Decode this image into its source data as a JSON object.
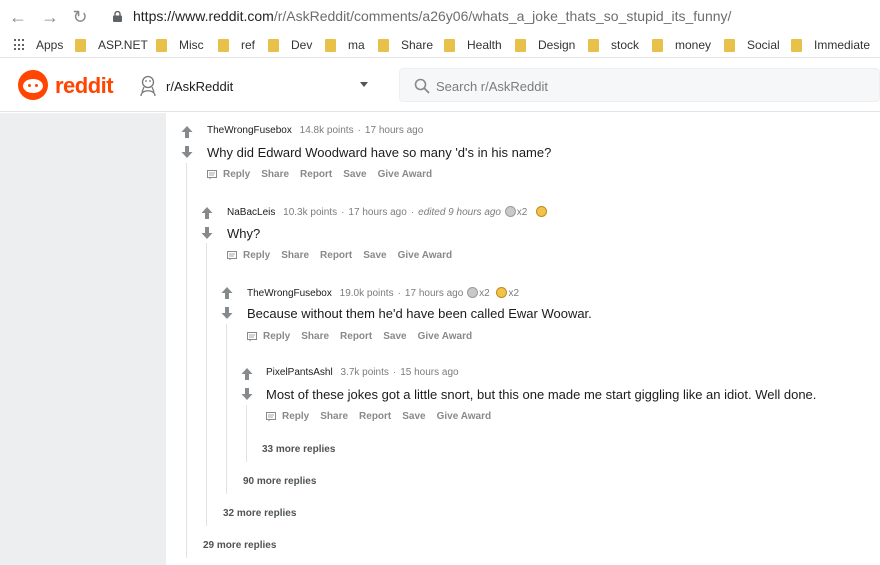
{
  "browser": {
    "url_host": "https://www.reddit.com",
    "url_path": "/r/AskReddit/comments/a26y06/whats_a_joke_thats_so_stupid_its_funny/"
  },
  "bookmarks": [
    "Apps",
    "ASP.NET",
    "Misc",
    "ref",
    "Dev",
    "ma",
    "Share",
    "Health",
    "Design",
    "stock",
    "money",
    "Social",
    "Immediate"
  ],
  "header": {
    "logo_text": "reddit",
    "subreddit": "r/AskReddit",
    "search_placeholder": "Search r/AskReddit"
  },
  "actions": {
    "reply": "Reply",
    "share": "Share",
    "report": "Report",
    "save": "Save",
    "give_award": "Give Award"
  },
  "comments": [
    {
      "author": "TheWrongFusebox",
      "points": "14.8k points",
      "time": "17 hours ago",
      "text": "Why did Edward Woodward have so many 'd's in his name?"
    },
    {
      "author": "NaBacLeis",
      "points": "10.3k points",
      "time": "17 hours ago",
      "edited": "edited 9 hours ago",
      "award_silver_count": "x2",
      "text": "Why?"
    },
    {
      "author": "TheWrongFusebox",
      "points": "19.0k points",
      "time": "17 hours ago",
      "award_silver_count": "x2",
      "award_gold_count": "x2",
      "text": "Because without them he'd have been called Ewar Woowar."
    },
    {
      "author": "PixelPantsAshl",
      "points": "3.7k points",
      "time": "15 hours ago",
      "text": "Most of these jokes got a little snort, but this one made me start giggling like an idiot. Well done."
    }
  ],
  "more_replies": [
    "33 more replies",
    "90 more replies",
    "32 more replies",
    "29 more replies"
  ],
  "colors": {
    "brand": "#ff4500",
    "meta_text": "#7c7c7c",
    "action_text": "#878a8c",
    "left_band": "#eceef0"
  }
}
